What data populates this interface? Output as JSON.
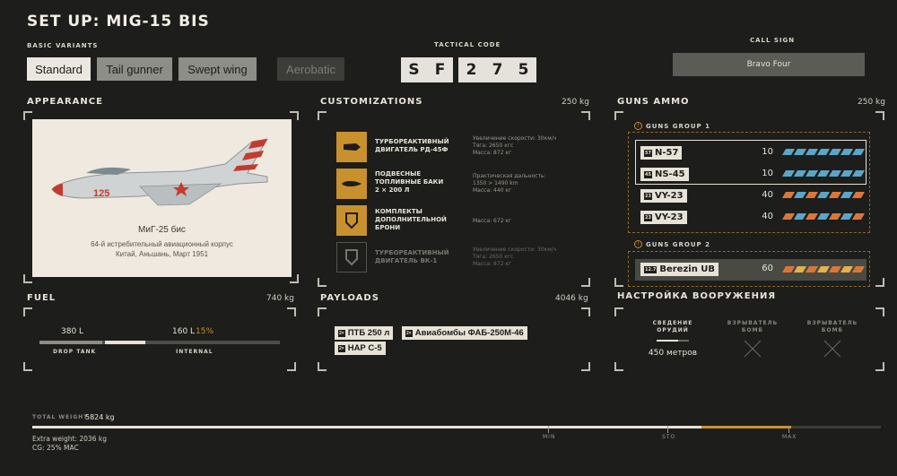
{
  "header": {
    "title": "SET UP:  MIG-15 BIS"
  },
  "variants": {
    "label": "BASIC VARIANTS",
    "items": [
      "Standard",
      "Tail gunner",
      "Swept wing",
      "Aerobatic"
    ]
  },
  "tactical": {
    "label": "TACTICAL CODE",
    "chars": [
      "S",
      "F",
      "2",
      "7",
      "5"
    ]
  },
  "callsign": {
    "label": "CALL SIGN",
    "value": "Bravo Four"
  },
  "appearance": {
    "label": "APPEARANCE",
    "plane_number": "125",
    "name": "МиГ-25 бис",
    "line1": "64-й истребительный авиационный корпус",
    "line2": "Китай, Аньшань, Март 1951"
  },
  "customizations": {
    "label": "CUSTOMIZATIONS",
    "weight": "250 kg",
    "items": [
      {
        "name": "ТУРБОРЕАКТИВНЫЙ\nДВИГАТЕЛЬ РД-45Ф",
        "desc": "Увеличение скорости: 30км/ч\nТяга: 2650 кгс\nМасса: 872 кг",
        "icon": "engine-icon",
        "active": true
      },
      {
        "name": "ПОДВЕСНЫЕ\nТОПЛИВНЫЕ БАКИ\n2 × 200 Л",
        "desc": "Практическая дальность:\n1350 > 1490 km\nМасса: 440 кг",
        "icon": "fuel-tank-icon",
        "active": true
      },
      {
        "name": "КОМПЛЕКТЫ\nДОПОЛНИТЕЛЬНОЙ\nБРОНИ",
        "desc": "Масса: 672 кг",
        "icon": "armor-icon",
        "active": true
      },
      {
        "name": "ТУРБОРЕАКТИВНЫЙ\nДВИГАТЕЛЬ ВК-1",
        "desc": "Увеличение скорости: 30км/ч\nТяга: 2650 кгс\nМасса: 872 кг",
        "icon": "armor-icon",
        "active": false
      }
    ]
  },
  "guns": {
    "label": "GUNS AMMO",
    "weight": "250 kg",
    "group1": {
      "label": "GUNS GROUP 1",
      "items": [
        {
          "size": "57",
          "name": "N-57",
          "count": "10"
        },
        {
          "size": "45",
          "name": "NS-45",
          "count": "10"
        },
        {
          "size": "23",
          "name": "VY-23",
          "count": "40"
        },
        {
          "size": "23",
          "name": "VY-23",
          "count": "40"
        }
      ]
    },
    "group2": {
      "label": "GUNS GROUP 2",
      "items": [
        {
          "size": "12.7",
          "name": "Berezin UB",
          "count": "60"
        }
      ]
    }
  },
  "fuel": {
    "label": "FUEL",
    "weight": "740 kg",
    "drop_value": "380 L",
    "drop_label": "DROP TANK",
    "internal_value": "160 L",
    "internal_pct": "15%",
    "internal_label": "INTERNAL"
  },
  "payloads": {
    "label": "PAYLOADS",
    "weight": "4046 kg",
    "items": [
      {
        "size": "2×",
        "name": "ПТБ 250 л"
      },
      {
        "size": "2×",
        "name": "Авиабомбы ФАБ-250М-46"
      },
      {
        "size": "2×",
        "name": "НАР С-5"
      }
    ]
  },
  "armament": {
    "label": "НАСТРОЙКА ВООРУЖЕНИЯ",
    "items": [
      {
        "label": "СВЕДЕНИЕ\nОРУДИЙ",
        "value": "450 метров"
      },
      {
        "label": "ВЗРЫВАТЕЛЬ\nБОМБ",
        "value": ""
      },
      {
        "label": "ВЗРЫВАТЕЛЬ\nБОМБ",
        "value": ""
      }
    ]
  },
  "weight": {
    "label": "TOTAL WEIGHT",
    "value": "5824 kg",
    "extra": "Extra weight: 2036 kg",
    "cg": "CG: 25% MAC",
    "ticks": [
      "MIN",
      "STO",
      "MAX"
    ],
    "fill_fraction": 0.75
  },
  "colors": {
    "accent": "#c9912e",
    "ammo_blue": "#5aa6c8",
    "ammo_orange": "#d9773a",
    "selected_variant": "#e9e7df"
  }
}
